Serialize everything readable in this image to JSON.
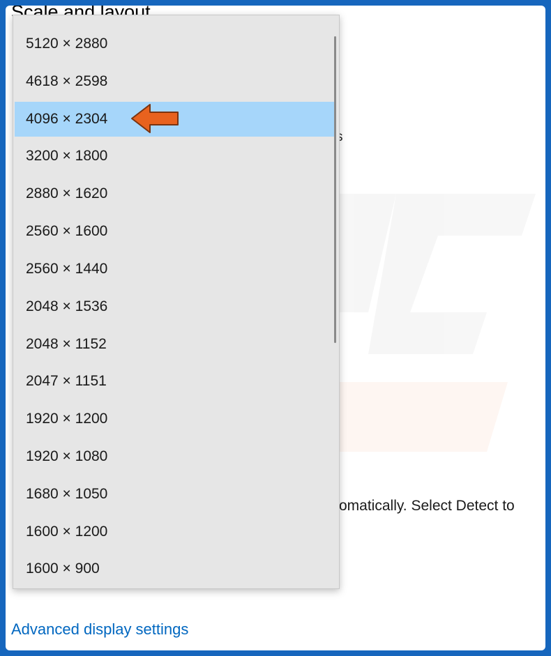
{
  "settings": {
    "section_heading": "Scale and layout",
    "partial_text": "s",
    "detect_text": "omatically. Select Detect to",
    "advanced_link": "Advanced display settings"
  },
  "resolution_dropdown": {
    "options": [
      "5120 × 2880",
      "4618 × 2598",
      "4096 × 2304",
      "3200 × 1800",
      "2880 × 1620",
      "2560 × 1600",
      "2560 × 1440",
      "2048 × 1536",
      "2048 × 1152",
      "2047 × 1151",
      "1920 × 1200",
      "1920 × 1080",
      "1680 × 1050",
      "1600 × 1200",
      "1600 × 900"
    ],
    "selected_index": 2
  },
  "annotation": {
    "arrow_icon": "left-arrow-icon",
    "arrow_color": "#e8621e"
  },
  "colors": {
    "border": "#1666bd",
    "selection": "#a6d6fa",
    "link": "#0067c0"
  }
}
